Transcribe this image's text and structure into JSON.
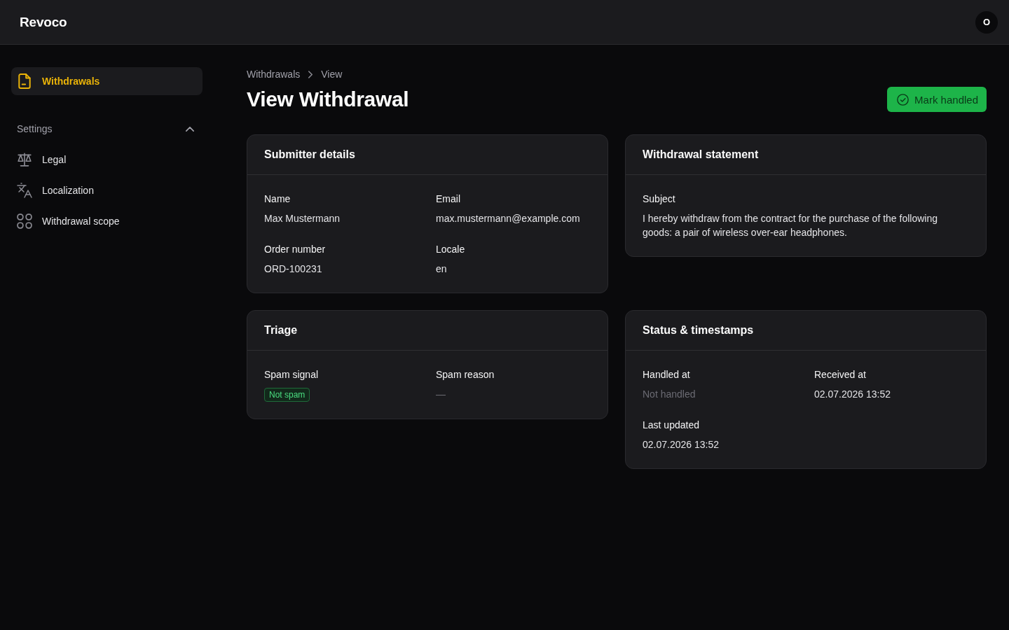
{
  "header": {
    "brand": "Revoco",
    "avatar": "O"
  },
  "sidebar": {
    "items": [
      {
        "label": "Withdrawals",
        "selected": true
      }
    ],
    "sections": [
      {
        "title": "Settings",
        "expanded": true,
        "items": [
          {
            "label": "Legal",
            "selected": false
          },
          {
            "label": "Localization",
            "selected": false
          },
          {
            "label": "Withdrawal scope",
            "selected": false
          }
        ]
      }
    ]
  },
  "breadcrumb": [
    {
      "label": "Withdrawals"
    },
    {
      "label": "View"
    }
  ],
  "title": "View Withdrawal",
  "action": {
    "label": "Mark handled"
  },
  "cards": [
    {
      "title": "Submitter details",
      "fields": [
        {
          "label": "Name",
          "value": "Max Mustermann",
          "kind": "text"
        },
        {
          "label": "Email",
          "value": "max.mustermann@example.com",
          "kind": "text"
        },
        {
          "label": "Order number",
          "value": "ORD-100231",
          "kind": "text"
        },
        {
          "label": "Locale",
          "value": "en",
          "kind": "text"
        }
      ]
    },
    {
      "title": "Withdrawal statement",
      "fields": [
        {
          "label": "Subject",
          "value": "I hereby withdraw from the contract for the purchase of the following goods: a pair of wireless over-ear headphones.",
          "kind": "paragraph"
        }
      ]
    },
    {
      "title": "Triage",
      "fields": [
        {
          "label": "Spam signal",
          "value": "Not spam",
          "kind": "badge"
        },
        {
          "label": "Spam reason",
          "value": "—",
          "kind": "muted"
        }
      ]
    },
    {
      "title": "Status & timestamps",
      "fields": [
        {
          "label": "Handled at",
          "value": "Not handled",
          "kind": "muted"
        },
        {
          "label": "Received at",
          "value": "02.07.2026 13:52",
          "kind": "text"
        },
        {
          "label": "Last updated",
          "value": "02.07.2026 13:52",
          "kind": "text"
        }
      ]
    }
  ]
}
